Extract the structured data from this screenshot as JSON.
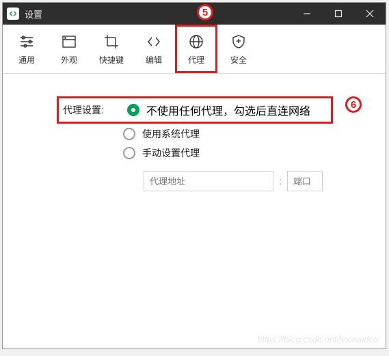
{
  "titlebar": {
    "title": "设置"
  },
  "toolbar": {
    "items": [
      {
        "label": "通用"
      },
      {
        "label": "外观"
      },
      {
        "label": "快捷键"
      },
      {
        "label": "编辑"
      },
      {
        "label": "代理"
      },
      {
        "label": "安全"
      }
    ]
  },
  "proxy": {
    "label": "代理设置:",
    "options": [
      "不使用任何代理，勾选后直连网络",
      "使用系统代理",
      "手动设置代理"
    ],
    "address_placeholder": "代理地址",
    "port_placeholder": "端口",
    "colon": ":"
  },
  "badges": {
    "b5": "5",
    "b6": "6"
  },
  "watermark": "https://blog.csdn.net/lvxinaidou"
}
